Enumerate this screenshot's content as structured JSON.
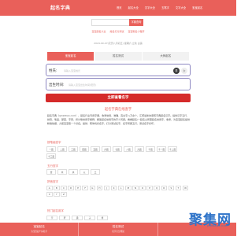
{
  "header": {
    "logo": "起名字典",
    "nav": [
      "首页",
      "起名大全",
      "汉字大全",
      "五笔字",
      "文字大全",
      "宝宝起名"
    ]
  },
  "search": {
    "placeholder": "",
    "button": "字典查询"
  },
  "tags": [
    "宝宝起名大全",
    "姓名打分测试",
    "宝宝取名小程序"
  ],
  "datetime": "2024-09-07(农历八月初五) 星期六 立秋 白露",
  "tabs": [
    "宝宝起名",
    "姓名测试",
    "大师起名"
  ],
  "form": {
    "surname_label": "姓氏:",
    "surname_placeholder": "请输入宝宝姓氏",
    "gender_male": "男",
    "gender_female": "女",
    "birth_label": "出生时间:",
    "birth_placeholder": "请输入宝宝出生时间(阳历)",
    "submit": "立即查看名字"
  },
  "intro": {
    "title": "起名字典在线查字",
    "text": "起名字典（qmzidian.com），起名行业专用字典，收录常用、准确、完全字八万余个，汇聚最新的康熙字典起名汉字。提供汉字五行、拼音、笔画、部首、字意、拆分等常用字解释，解答起名常用字的字义问题。看看起名/一起名之所需起名常用字，收录，为宝宝起名提供精准依据，力促宝宝取一个好名。提供：帮你找好名字，打分测试名字，名字所属五行，测试名字好坏。"
  },
  "strokes": {
    "label": "按笔画查字",
    "row1": [
      "一画",
      "二画",
      "三画",
      "四画",
      "五画",
      "六画",
      "七画",
      "八画",
      "九画",
      "十画",
      "十一画",
      "十二画"
    ],
    "row2": [
      "十三画"
    ]
  },
  "wuxing": {
    "label": "五行查字",
    "items": [
      "金",
      "木",
      "水",
      "火",
      "土"
    ]
  },
  "pinyin": {
    "label": "拼音查字",
    "row1": [
      "A",
      "B",
      "C",
      "D",
      "E",
      "F",
      "G",
      "H",
      "J",
      "K",
      "L",
      "M",
      "N",
      "O",
      "P",
      "Q",
      "R",
      "S",
      "T",
      "W"
    ],
    "row2": [
      "X",
      "Y",
      "Z"
    ]
  },
  "popular": {
    "label": "热门起名用字",
    "items": [
      "宇",
      "轩",
      "涵",
      "子",
      "梓"
    ]
  },
  "bottom": [
    {
      "title": "宝宝起名",
      "sub": "为宝宝起个好名字"
    },
    {
      "title": "姓名测试",
      "sub": "名字打分测试"
    },
    {
      "title": "",
      "sub": ""
    }
  ],
  "watermark": {
    "text": "聚集网",
    "sub": "JUJIWANG.COM"
  }
}
